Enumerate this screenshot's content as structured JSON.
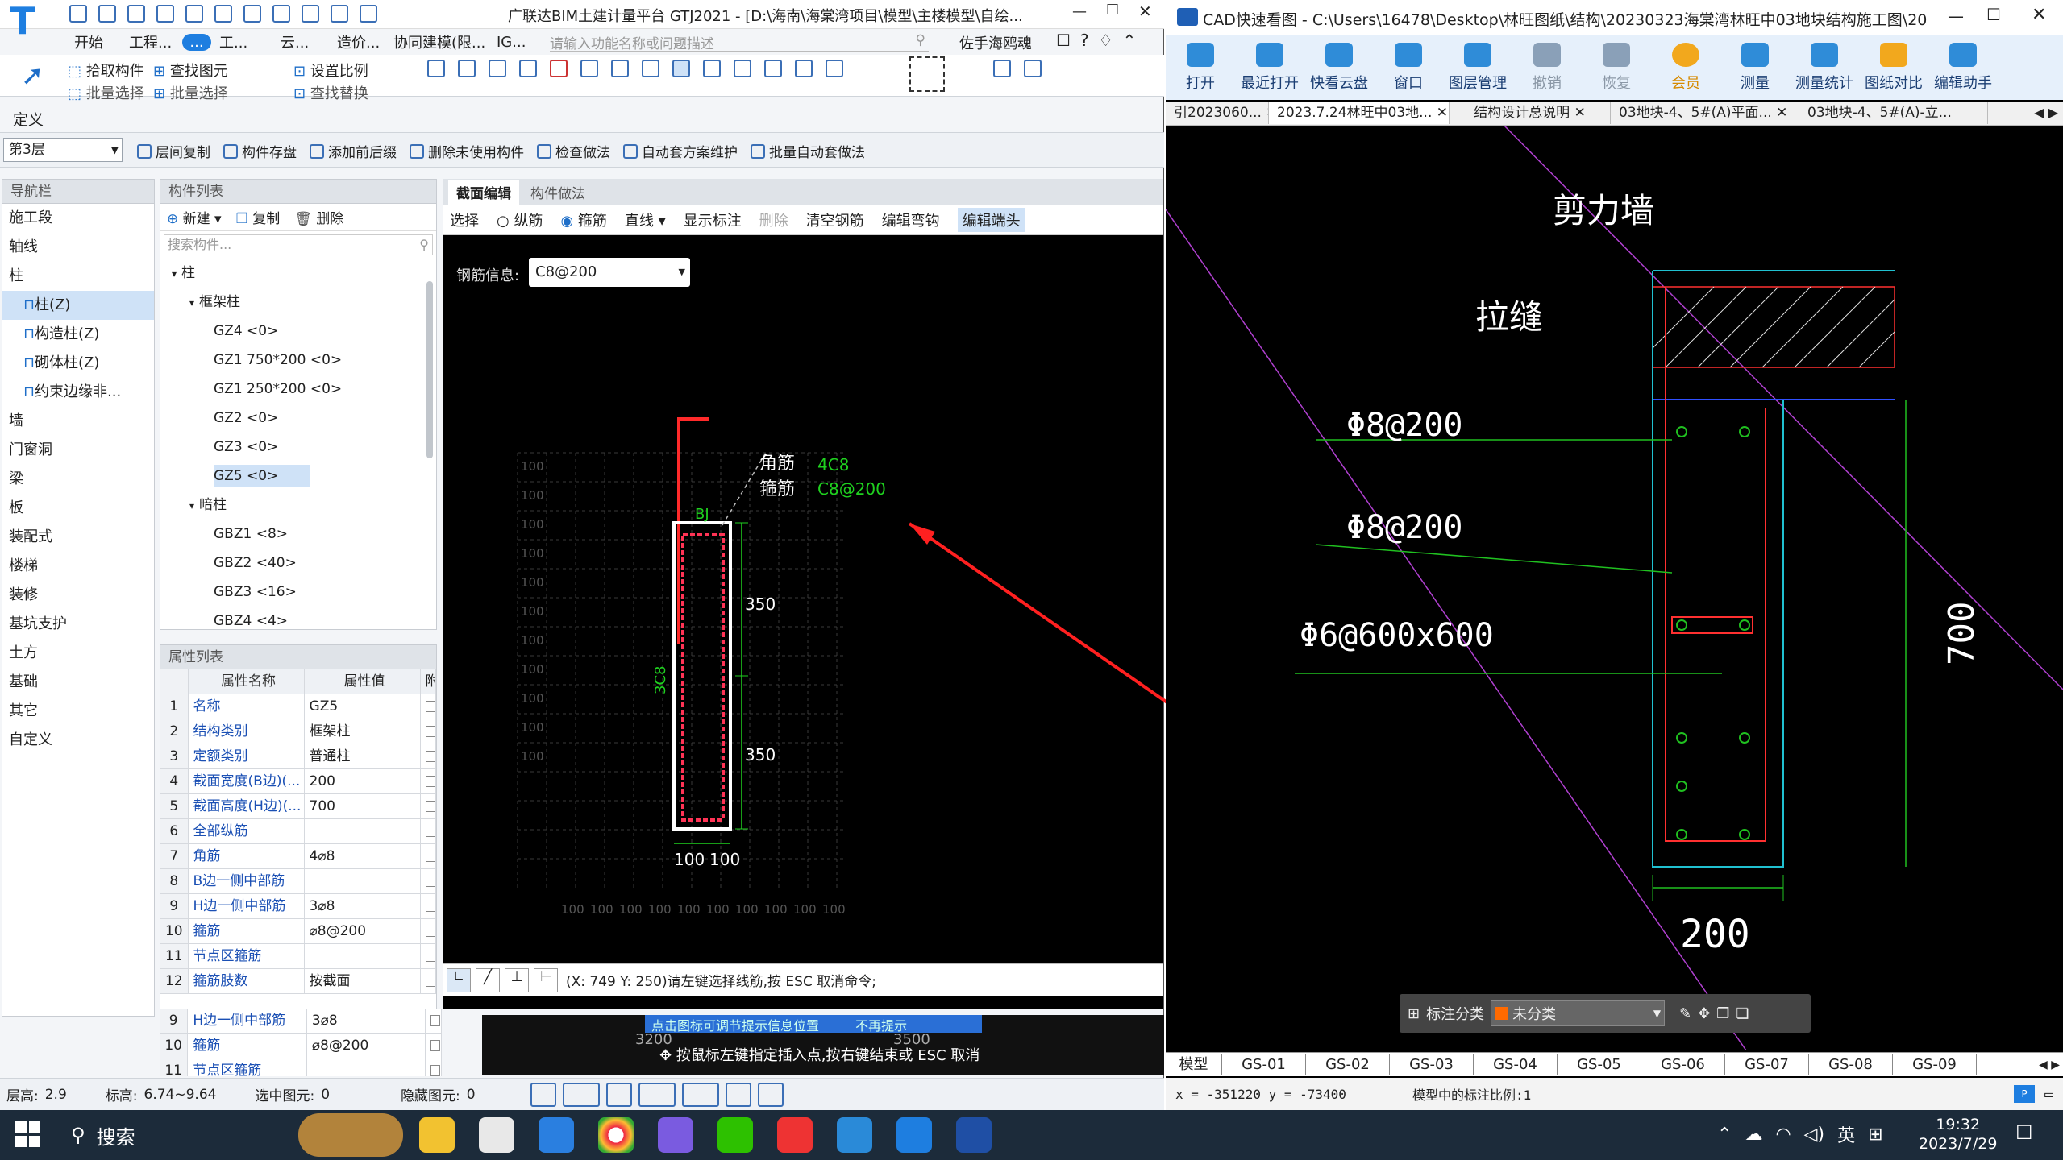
{
  "left_app": {
    "title": "广联达BIM土建计量平台 GTJ2021 - [D:\\海南\\海棠湾项目\\模型\\主楼模型\\自绘...",
    "ribbon_tabs": [
      "开始",
      "工程...",
      "...",
      "工...",
      "云...",
      "造价...",
      "协同建模(限...",
      "IG..."
    ],
    "search_placeholder": "请输入功能名称或问题描述",
    "user": "佐手海鸥魂",
    "tools": [
      "拾取构件",
      "查找图元",
      "设置比例",
      "批量选择",
      "批量选择",
      "查找替换"
    ],
    "define_label": "定义",
    "floor": "第3层",
    "toolbar2": [
      "层间复制",
      "构件存盘",
      "添加前后缀",
      "删除未使用构件",
      "检查做法",
      "自动套方案维护",
      "批量自动套做法"
    ],
    "nav_title": "导航栏",
    "nav_items": [
      "施工段",
      "轴线",
      "柱",
      "柱(Z)",
      "构造柱(Z)",
      "砌体柱(Z)",
      "约束边缘非...",
      "墙",
      "门窗洞",
      "梁",
      "板",
      "装配式",
      "楼梯",
      "装修",
      "基坑支护",
      "土方",
      "基础",
      "其它",
      "自定义"
    ],
    "comp_title": "构件列表",
    "comp_actions": [
      "新建",
      "复制",
      "删除"
    ],
    "comp_search": "搜索构件...",
    "tree": [
      "柱",
      "框架柱",
      "GZ4 <0>",
      "GZ1 750*200 <0>",
      "GZ1 250*200 <0>",
      "GZ2 <0>",
      "GZ3 <0>",
      "GZ5 <0>",
      "暗柱",
      "GBZ1 <8>",
      "GBZ2 <40>",
      "GBZ3 <16>",
      "GBZ4 <4>"
    ],
    "prop_title": "属性列表",
    "prop_header": [
      "属性名称",
      "属性值",
      "附"
    ],
    "props": [
      [
        "1",
        "名称",
        "GZ5"
      ],
      [
        "2",
        "结构类别",
        "框架柱"
      ],
      [
        "3",
        "定额类别",
        "普通柱"
      ],
      [
        "4",
        "截面宽度(B边)(...",
        "200"
      ],
      [
        "5",
        "截面高度(H边)(...",
        "700"
      ],
      [
        "6",
        "全部纵筋",
        ""
      ],
      [
        "7",
        "角筋",
        "4⌀8"
      ],
      [
        "8",
        "B边一侧中部筋",
        ""
      ],
      [
        "9",
        "H边一侧中部筋",
        "3⌀8"
      ],
      [
        "10",
        "箍筋",
        "⌀8@200"
      ],
      [
        "11",
        "节点区箍筋",
        ""
      ],
      [
        "12",
        "箍筋肢数",
        "按截面"
      ]
    ],
    "props_below": [
      [
        "9",
        "H边一侧中部筋",
        "3⌀8"
      ],
      [
        "10",
        "箍筋",
        "⌀8@200"
      ],
      [
        "11",
        "节点区箍筋",
        ""
      ]
    ],
    "edit_tabs": [
      "截面编辑",
      "构件做法"
    ],
    "edit_tools": [
      "选择",
      "纵筋",
      "箍筋",
      "直线",
      "显示标注",
      "删除",
      "清空钢筋",
      "编辑弯钩",
      "编辑端头"
    ],
    "rebar_info_label": "钢筋信息:",
    "rebar_info_value": "C8@200",
    "canvas": {
      "corner_label": "角筋",
      "stirrup_label": "箍筋",
      "corner_val": "4C8",
      "stirrup_val": "C8@200",
      "bj": "BJ",
      "side": "3C8",
      "dim1": "350",
      "dim2": "350",
      "w1": "100",
      "w2": "100",
      "grid_label": "100"
    },
    "command": "(X: 749 Y: 250)请左键选择线筋,按 ESC 取消命令;",
    "hint_a": "点击图标可调节提示信息位置",
    "hint_b": "不再提示",
    "hint_c": "按鼠标左键指定插入点,按右键结束或 ESC 取消",
    "hint_dim": "3200",
    "hint_dim2": "3500",
    "status": {
      "floor_h_label": "层高:",
      "floor_h": "2.9",
      "elev_label": "标高:",
      "elev": "6.74~9.64",
      "sel_label": "选中图元:",
      "sel": "0",
      "hidden_label": "隐藏图元:",
      "hidden": "0"
    }
  },
  "right_app": {
    "title": "CAD快速看图 - C:\\Users\\16478\\Desktop\\林旺图纸\\结构\\20230323海棠湾林旺中03地块结构施工图\\20...",
    "buttons": [
      "打开",
      "最近打开",
      "快看云盘",
      "窗口",
      "图层管理",
      "撤销",
      "恢复",
      "会员",
      "测量",
      "测量统计",
      "图纸对比",
      "编辑助手"
    ],
    "tabs": [
      "引2023060...",
      "2023.7.24林旺中03地...",
      "结构设计总说明",
      "03地块-4、5#(A)平面...",
      "03地块-4、5#(A)-立..."
    ],
    "drawing": {
      "shear_wall": "剪力墙",
      "tie_seam": "拉缝",
      "r1": "Φ8@200",
      "r2": "Φ8@200",
      "r3": "Φ6@600x600",
      "h": "700",
      "w": "200"
    },
    "anno_label": "标注分类",
    "anno_value": "未分类",
    "sheet_tabs": [
      "模型",
      "GS-01",
      "GS-02",
      "GS-03",
      "GS-04",
      "GS-05",
      "GS-06",
      "GS-07",
      "GS-08",
      "GS-09"
    ],
    "coords": "x = -351220  y = -73400",
    "scale": "模型中的标注比例:1"
  },
  "taskbar": {
    "search": "搜索",
    "ime": "英",
    "time": "19:32",
    "date": "2023/7/29"
  }
}
